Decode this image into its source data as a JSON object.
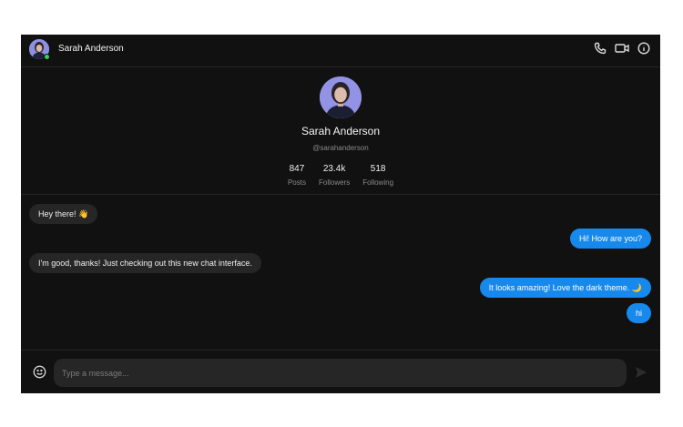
{
  "header": {
    "name": "Sarah Anderson",
    "icons": [
      "phone-icon",
      "video-icon",
      "info-icon"
    ]
  },
  "profile": {
    "name": "Sarah Anderson",
    "handle": "@sarahanderson",
    "stats": [
      {
        "value": "847",
        "label": "Posts"
      },
      {
        "value": "23.4k",
        "label": "Followers"
      },
      {
        "value": "518",
        "label": "Following"
      }
    ]
  },
  "messages": [
    {
      "from": "them",
      "text": "Hey there! 👋"
    },
    {
      "from": "me",
      "text": "Hi! How are you?"
    },
    {
      "from": "them",
      "text": "I'm good, thanks! Just checking out this new chat interface."
    },
    {
      "from": "me",
      "text": "It looks amazing! Love the dark theme. 🌙"
    },
    {
      "from": "me",
      "text": "hi"
    }
  ],
  "composer": {
    "placeholder": "Type a message...",
    "value": ""
  },
  "colors": {
    "background": "#111111",
    "outgoing_bubble": "#1789ec",
    "incoming_bubble": "#262626",
    "online": "#3ecf5b"
  }
}
